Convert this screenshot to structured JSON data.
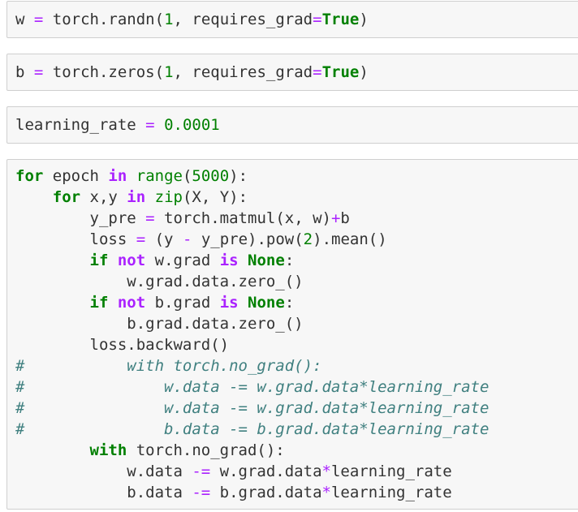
{
  "cells": [
    {
      "lines": [
        [
          {
            "t": "w ",
            "c": "plain"
          },
          {
            "t": "=",
            "c": "op"
          },
          {
            "t": " torch.randn(",
            "c": "plain"
          },
          {
            "t": "1",
            "c": "num"
          },
          {
            "t": ", requires_grad",
            "c": "plain"
          },
          {
            "t": "=",
            "c": "op"
          },
          {
            "t": "True",
            "c": "kw"
          },
          {
            "t": ")",
            "c": "plain"
          }
        ]
      ]
    },
    {
      "lines": [
        [
          {
            "t": "b ",
            "c": "plain"
          },
          {
            "t": "=",
            "c": "op"
          },
          {
            "t": " torch.zeros(",
            "c": "plain"
          },
          {
            "t": "1",
            "c": "num"
          },
          {
            "t": ", requires_grad",
            "c": "plain"
          },
          {
            "t": "=",
            "c": "op"
          },
          {
            "t": "True",
            "c": "kw"
          },
          {
            "t": ")",
            "c": "plain"
          }
        ]
      ]
    },
    {
      "lines": [
        [
          {
            "t": "learning_rate ",
            "c": "plain"
          },
          {
            "t": "=",
            "c": "op"
          },
          {
            "t": " ",
            "c": "plain"
          },
          {
            "t": "0.0001",
            "c": "num"
          }
        ]
      ]
    },
    {
      "lines": [
        [
          {
            "t": "for",
            "c": "kw"
          },
          {
            "t": " epoch ",
            "c": "plain"
          },
          {
            "t": "in",
            "c": "opb"
          },
          {
            "t": " ",
            "c": "plain"
          },
          {
            "t": "range",
            "c": "bi"
          },
          {
            "t": "(",
            "c": "plain"
          },
          {
            "t": "5000",
            "c": "num"
          },
          {
            "t": "):",
            "c": "plain"
          }
        ],
        [
          {
            "t": "    ",
            "c": "plain"
          },
          {
            "t": "for",
            "c": "kw"
          },
          {
            "t": " x,y ",
            "c": "plain"
          },
          {
            "t": "in",
            "c": "opb"
          },
          {
            "t": " ",
            "c": "plain"
          },
          {
            "t": "zip",
            "c": "bi"
          },
          {
            "t": "(X, Y):",
            "c": "plain"
          }
        ],
        [
          {
            "t": "        y_pre ",
            "c": "plain"
          },
          {
            "t": "=",
            "c": "op"
          },
          {
            "t": " torch.matmul(x, w)",
            "c": "plain"
          },
          {
            "t": "+",
            "c": "op"
          },
          {
            "t": "b",
            "c": "plain"
          }
        ],
        [
          {
            "t": "        loss ",
            "c": "plain"
          },
          {
            "t": "=",
            "c": "op"
          },
          {
            "t": " (y ",
            "c": "plain"
          },
          {
            "t": "-",
            "c": "op"
          },
          {
            "t": " y_pre).pow(",
            "c": "plain"
          },
          {
            "t": "2",
            "c": "num"
          },
          {
            "t": ").mean()",
            "c": "plain"
          }
        ],
        [
          {
            "t": "        ",
            "c": "plain"
          },
          {
            "t": "if",
            "c": "kw"
          },
          {
            "t": " ",
            "c": "plain"
          },
          {
            "t": "not",
            "c": "opb"
          },
          {
            "t": " w.grad ",
            "c": "plain"
          },
          {
            "t": "is",
            "c": "opb"
          },
          {
            "t": " ",
            "c": "plain"
          },
          {
            "t": "None",
            "c": "kw"
          },
          {
            "t": ":",
            "c": "plain"
          }
        ],
        [
          {
            "t": "            w.grad.data.zero_()",
            "c": "plain"
          }
        ],
        [
          {
            "t": "        ",
            "c": "plain"
          },
          {
            "t": "if",
            "c": "kw"
          },
          {
            "t": " ",
            "c": "plain"
          },
          {
            "t": "not",
            "c": "opb"
          },
          {
            "t": " b.grad ",
            "c": "plain"
          },
          {
            "t": "is",
            "c": "opb"
          },
          {
            "t": " ",
            "c": "plain"
          },
          {
            "t": "None",
            "c": "kw"
          },
          {
            "t": ":",
            "c": "plain"
          }
        ],
        [
          {
            "t": "            b.grad.data.zero_()",
            "c": "plain"
          }
        ],
        [
          {
            "t": "        loss.backward()",
            "c": "plain"
          }
        ],
        [
          {
            "t": "#           with torch.no_grad():",
            "c": "cm"
          }
        ],
        [
          {
            "t": "#               w.data -= w.grad.data*learning_rate",
            "c": "cm"
          }
        ],
        [
          {
            "t": "#               w.data -= w.grad.data*learning_rate",
            "c": "cm"
          }
        ],
        [
          {
            "t": "#               b.data -= b.grad.data*learning_rate",
            "c": "cm"
          }
        ],
        [
          {
            "t": "        ",
            "c": "plain"
          },
          {
            "t": "with",
            "c": "kw"
          },
          {
            "t": " torch.no_grad():",
            "c": "plain"
          }
        ],
        [
          {
            "t": "            w.data ",
            "c": "plain"
          },
          {
            "t": "-=",
            "c": "op"
          },
          {
            "t": " w.grad.data",
            "c": "plain"
          },
          {
            "t": "*",
            "c": "op"
          },
          {
            "t": "learning_rate",
            "c": "plain"
          }
        ],
        [
          {
            "t": "            b.data ",
            "c": "plain"
          },
          {
            "t": "-=",
            "c": "op"
          },
          {
            "t": " b.grad.data",
            "c": "plain"
          },
          {
            "t": "*",
            "c": "op"
          },
          {
            "t": "learning_rate",
            "c": "plain"
          }
        ]
      ]
    }
  ]
}
